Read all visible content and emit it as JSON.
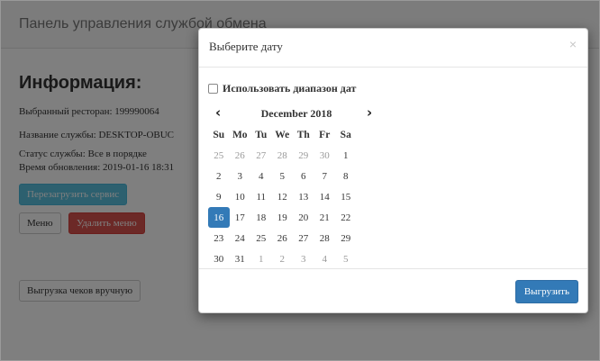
{
  "header": {
    "title": "Панель управления службой обмена"
  },
  "info": {
    "heading": "Информация:",
    "restaurant": "Выбранный ресторан: 199990064",
    "service_name": "Название службы: DESKTOP-OBUC",
    "status": "Статус службы: Все в порядке",
    "updated": "Время обновления: 2019-01-16 18:31"
  },
  "buttons": {
    "restart": "Перезагрузить сервис",
    "menu": "Меню",
    "delete_menu": "Удалить меню",
    "manual_upload": "Выгрузка чеков вручную"
  },
  "modal": {
    "title": "Выберите дату",
    "close": "×",
    "range_label": "Использовать диапазон дат",
    "range_checked": false,
    "export_button": "Выгрузить"
  },
  "calendar": {
    "prev": "‹",
    "next": "›",
    "month": "December 2018",
    "weekdays": [
      "Su",
      "Mo",
      "Tu",
      "We",
      "Th",
      "Fr",
      "Sa"
    ],
    "weeks": [
      [
        {
          "d": "25",
          "o": true
        },
        {
          "d": "26",
          "o": true
        },
        {
          "d": "27",
          "o": true
        },
        {
          "d": "28",
          "o": true
        },
        {
          "d": "29",
          "o": true
        },
        {
          "d": "30",
          "o": true
        },
        {
          "d": "1",
          "o": false
        }
      ],
      [
        {
          "d": "2",
          "o": false
        },
        {
          "d": "3",
          "o": false
        },
        {
          "d": "4",
          "o": false
        },
        {
          "d": "5",
          "o": false
        },
        {
          "d": "6",
          "o": false
        },
        {
          "d": "7",
          "o": false
        },
        {
          "d": "8",
          "o": false
        }
      ],
      [
        {
          "d": "9",
          "o": false
        },
        {
          "d": "10",
          "o": false
        },
        {
          "d": "11",
          "o": false
        },
        {
          "d": "12",
          "o": false
        },
        {
          "d": "13",
          "o": false
        },
        {
          "d": "14",
          "o": false
        },
        {
          "d": "15",
          "o": false
        }
      ],
      [
        {
          "d": "16",
          "o": false,
          "s": true
        },
        {
          "d": "17",
          "o": false
        },
        {
          "d": "18",
          "o": false
        },
        {
          "d": "19",
          "o": false
        },
        {
          "d": "20",
          "o": false
        },
        {
          "d": "21",
          "o": false
        },
        {
          "d": "22",
          "o": false
        }
      ],
      [
        {
          "d": "23",
          "o": false
        },
        {
          "d": "24",
          "o": false
        },
        {
          "d": "25",
          "o": false
        },
        {
          "d": "26",
          "o": false
        },
        {
          "d": "27",
          "o": false
        },
        {
          "d": "28",
          "o": false
        },
        {
          "d": "29",
          "o": false
        }
      ],
      [
        {
          "d": "30",
          "o": false
        },
        {
          "d": "31",
          "o": false
        },
        {
          "d": "1",
          "o": true
        },
        {
          "d": "2",
          "o": true
        },
        {
          "d": "3",
          "o": true
        },
        {
          "d": "4",
          "o": true
        },
        {
          "d": "5",
          "o": true
        }
      ]
    ]
  },
  "colors": {
    "primary": "#337ab7",
    "info": "#5bc0de",
    "danger": "#d9534f"
  }
}
